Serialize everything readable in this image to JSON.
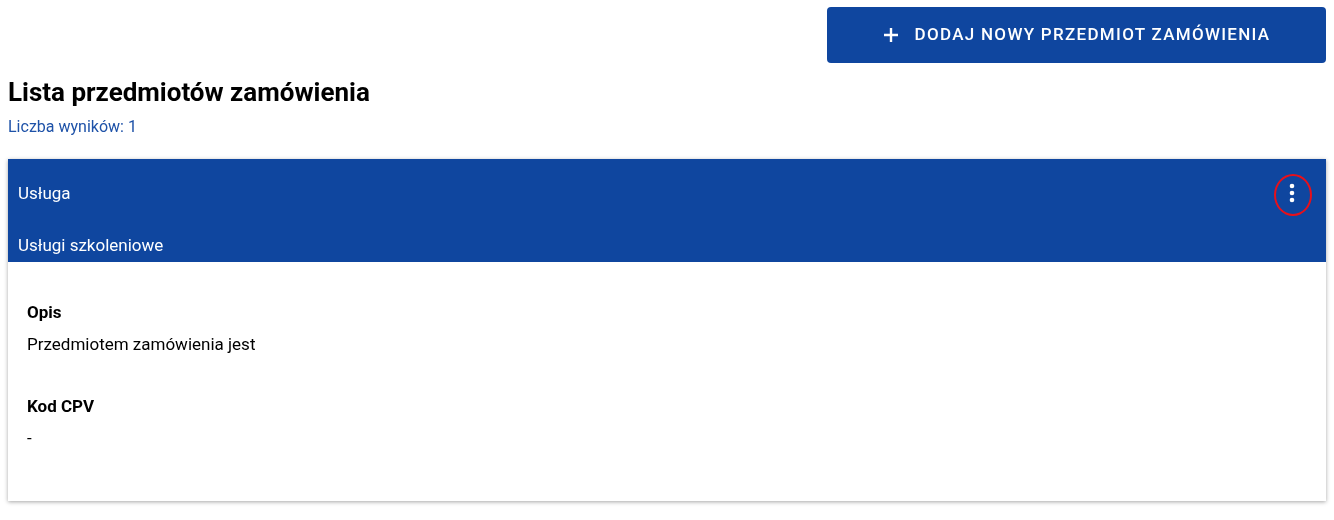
{
  "add_button": {
    "label": "DODAJ NOWY PRZEDMIOT ZAMÓWIENIA"
  },
  "heading": "Lista przedmiotów zamówienia",
  "result_count": "Liczba wyników: 1",
  "items": [
    {
      "type": "Usługa",
      "category": "Usługi szkoleniowe",
      "menu_highlighted": true,
      "fields": [
        {
          "label": "Opis",
          "value": "Przedmiotem zamówienia jest"
        },
        {
          "label": "Kod CPV",
          "value": "-"
        }
      ]
    }
  ]
}
